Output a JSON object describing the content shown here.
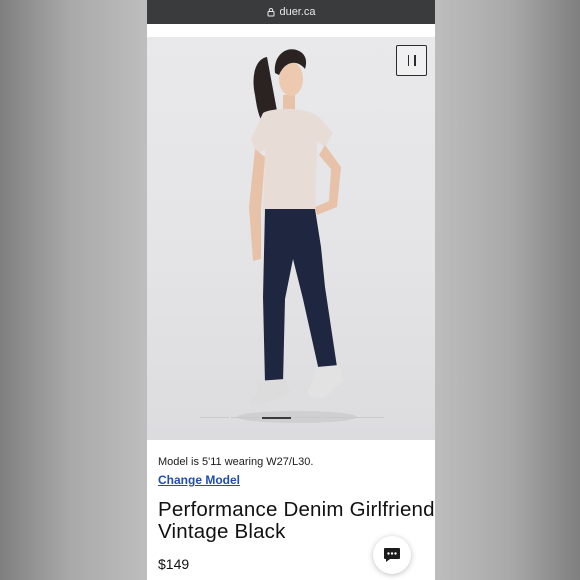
{
  "browser": {
    "url": "duer.ca"
  },
  "product": {
    "model_note": "Model is 5'11 wearing W27/L30.",
    "change_model_label": "Change Model",
    "title": "Performance Denim Girlfriend - Vintage Black",
    "price": "$149"
  },
  "carousel": {
    "slide_count": 6,
    "active_index": 2
  },
  "icons": {
    "pause": "pause-icon",
    "chat": "chat-bubble-icon",
    "lock": "lock-icon"
  },
  "colors": {
    "link": "#1f4fa8",
    "urlbar": "#3a3b3c"
  }
}
